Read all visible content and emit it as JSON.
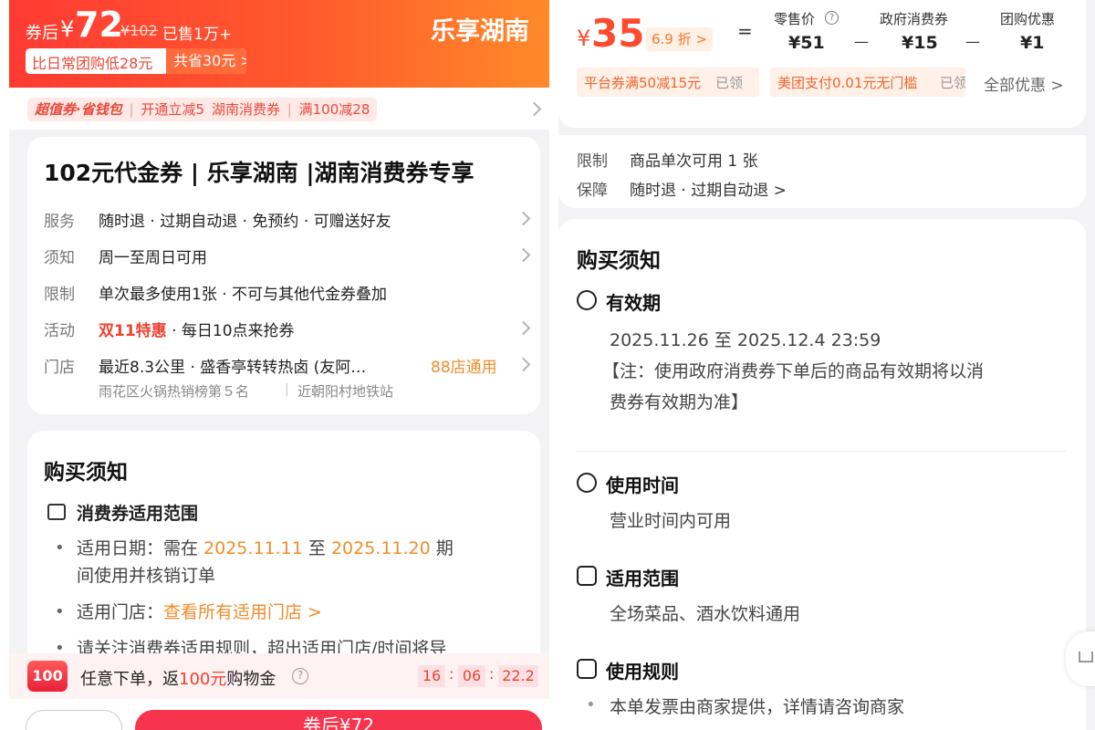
{
  "left": {
    "header": {
      "price_prefix": "券后",
      "currency": "¥",
      "price": "72",
      "original_price": "¥102",
      "sold": "已售1万+",
      "brand": "乐享湖南",
      "compare_text": "比日常团购低28元",
      "save_text": "共省30元 >"
    },
    "promo": {
      "tag1_a": "超值券·省钱包",
      "tag1_b": "开通立减5",
      "tag2_a": "湖南消费券",
      "tag2_b": "满100减28"
    },
    "product": {
      "title": "102元代金券 | 乐享湖南 |湖南消费券专享",
      "rows": [
        {
          "label": "服务",
          "value": "随时退 · 过期自动退 · 免预约 · 可赠送好友"
        },
        {
          "label": "须知",
          "value": "周一至周日可用"
        },
        {
          "label": "限制",
          "value": "单次最多使用1张 · 不可与其他代金券叠加"
        },
        {
          "label": "活动",
          "highlight": "双11特惠",
          "value": " · 每日10点来抢券"
        },
        {
          "label": "门店",
          "value": "最近8.3公里 · 盛香亭转转热卤 (友阿…",
          "extra": "88店通用"
        }
      ],
      "store_sub_a": "雨花区火锅热销榜第５名",
      "store_sub_b": "近朝阳村地铁站"
    },
    "notice": {
      "title": "购买须知",
      "section": "消费券适用范围",
      "date_a": "适用日期：需在 ",
      "date_start": "2025.11.11",
      "date_mid": " 至 ",
      "date_end": "2025.11.20",
      "date_b": " 期",
      "date_line2": "间使用并核销订单",
      "store_label": "适用门店：",
      "store_link": "查看所有适用门店 >",
      "cut_line": "请关注消费券适用规则，超出适用门店/时间将导"
    },
    "footer": {
      "badge": "100",
      "text_a": "任意下单，返",
      "text_amount": "100元",
      "text_b": "购物金",
      "timer_h": "16",
      "timer_m": "06",
      "timer_s": "22.2",
      "buy_label": "券后¥72"
    }
  },
  "right": {
    "top": {
      "currency": "¥",
      "price": "35",
      "discount": "6.9 折 >",
      "eq": "=",
      "minus": "—",
      "retail_label": "零售价",
      "retail_value": "¥51",
      "gov_label": "政府消费券",
      "gov_value": "¥15",
      "group_label": "团购优惠",
      "group_value": "¥1",
      "coupon1": "平台券满50减15元",
      "coupon1_state": "已领",
      "coupon2": "美团支付0.01元无门槛",
      "coupon2_state": "已领",
      "all": "全部优惠 >"
    },
    "limit": {
      "label1": "限制",
      "value1": "商品单次可用 1 张",
      "label2": "保障",
      "value2": "随时退 · 过期自动退 >"
    },
    "notice": {
      "title": "购买须知",
      "valid_title": "有效期",
      "valid_range": "2025.11.26 至 2025.12.4 23:59",
      "valid_note1": "【注：使用政府消费券下单后的商品有效期将以消",
      "valid_note2": "费券有效期为准】",
      "time_title": "使用时间",
      "time_text": "营业时间内可用",
      "scope_title": "适用范围",
      "scope_text": "全场菜品、酒水饮料通用",
      "rule_title": "使用规则",
      "rule_text": "本单发票由商家提供，详情请咨询商家"
    }
  },
  "colors": {
    "accent_red": "#ff3a33",
    "accent_orange": "#ff8a2a",
    "highlight_orange": "#f08c2a",
    "buy_button": "#f7344d"
  }
}
